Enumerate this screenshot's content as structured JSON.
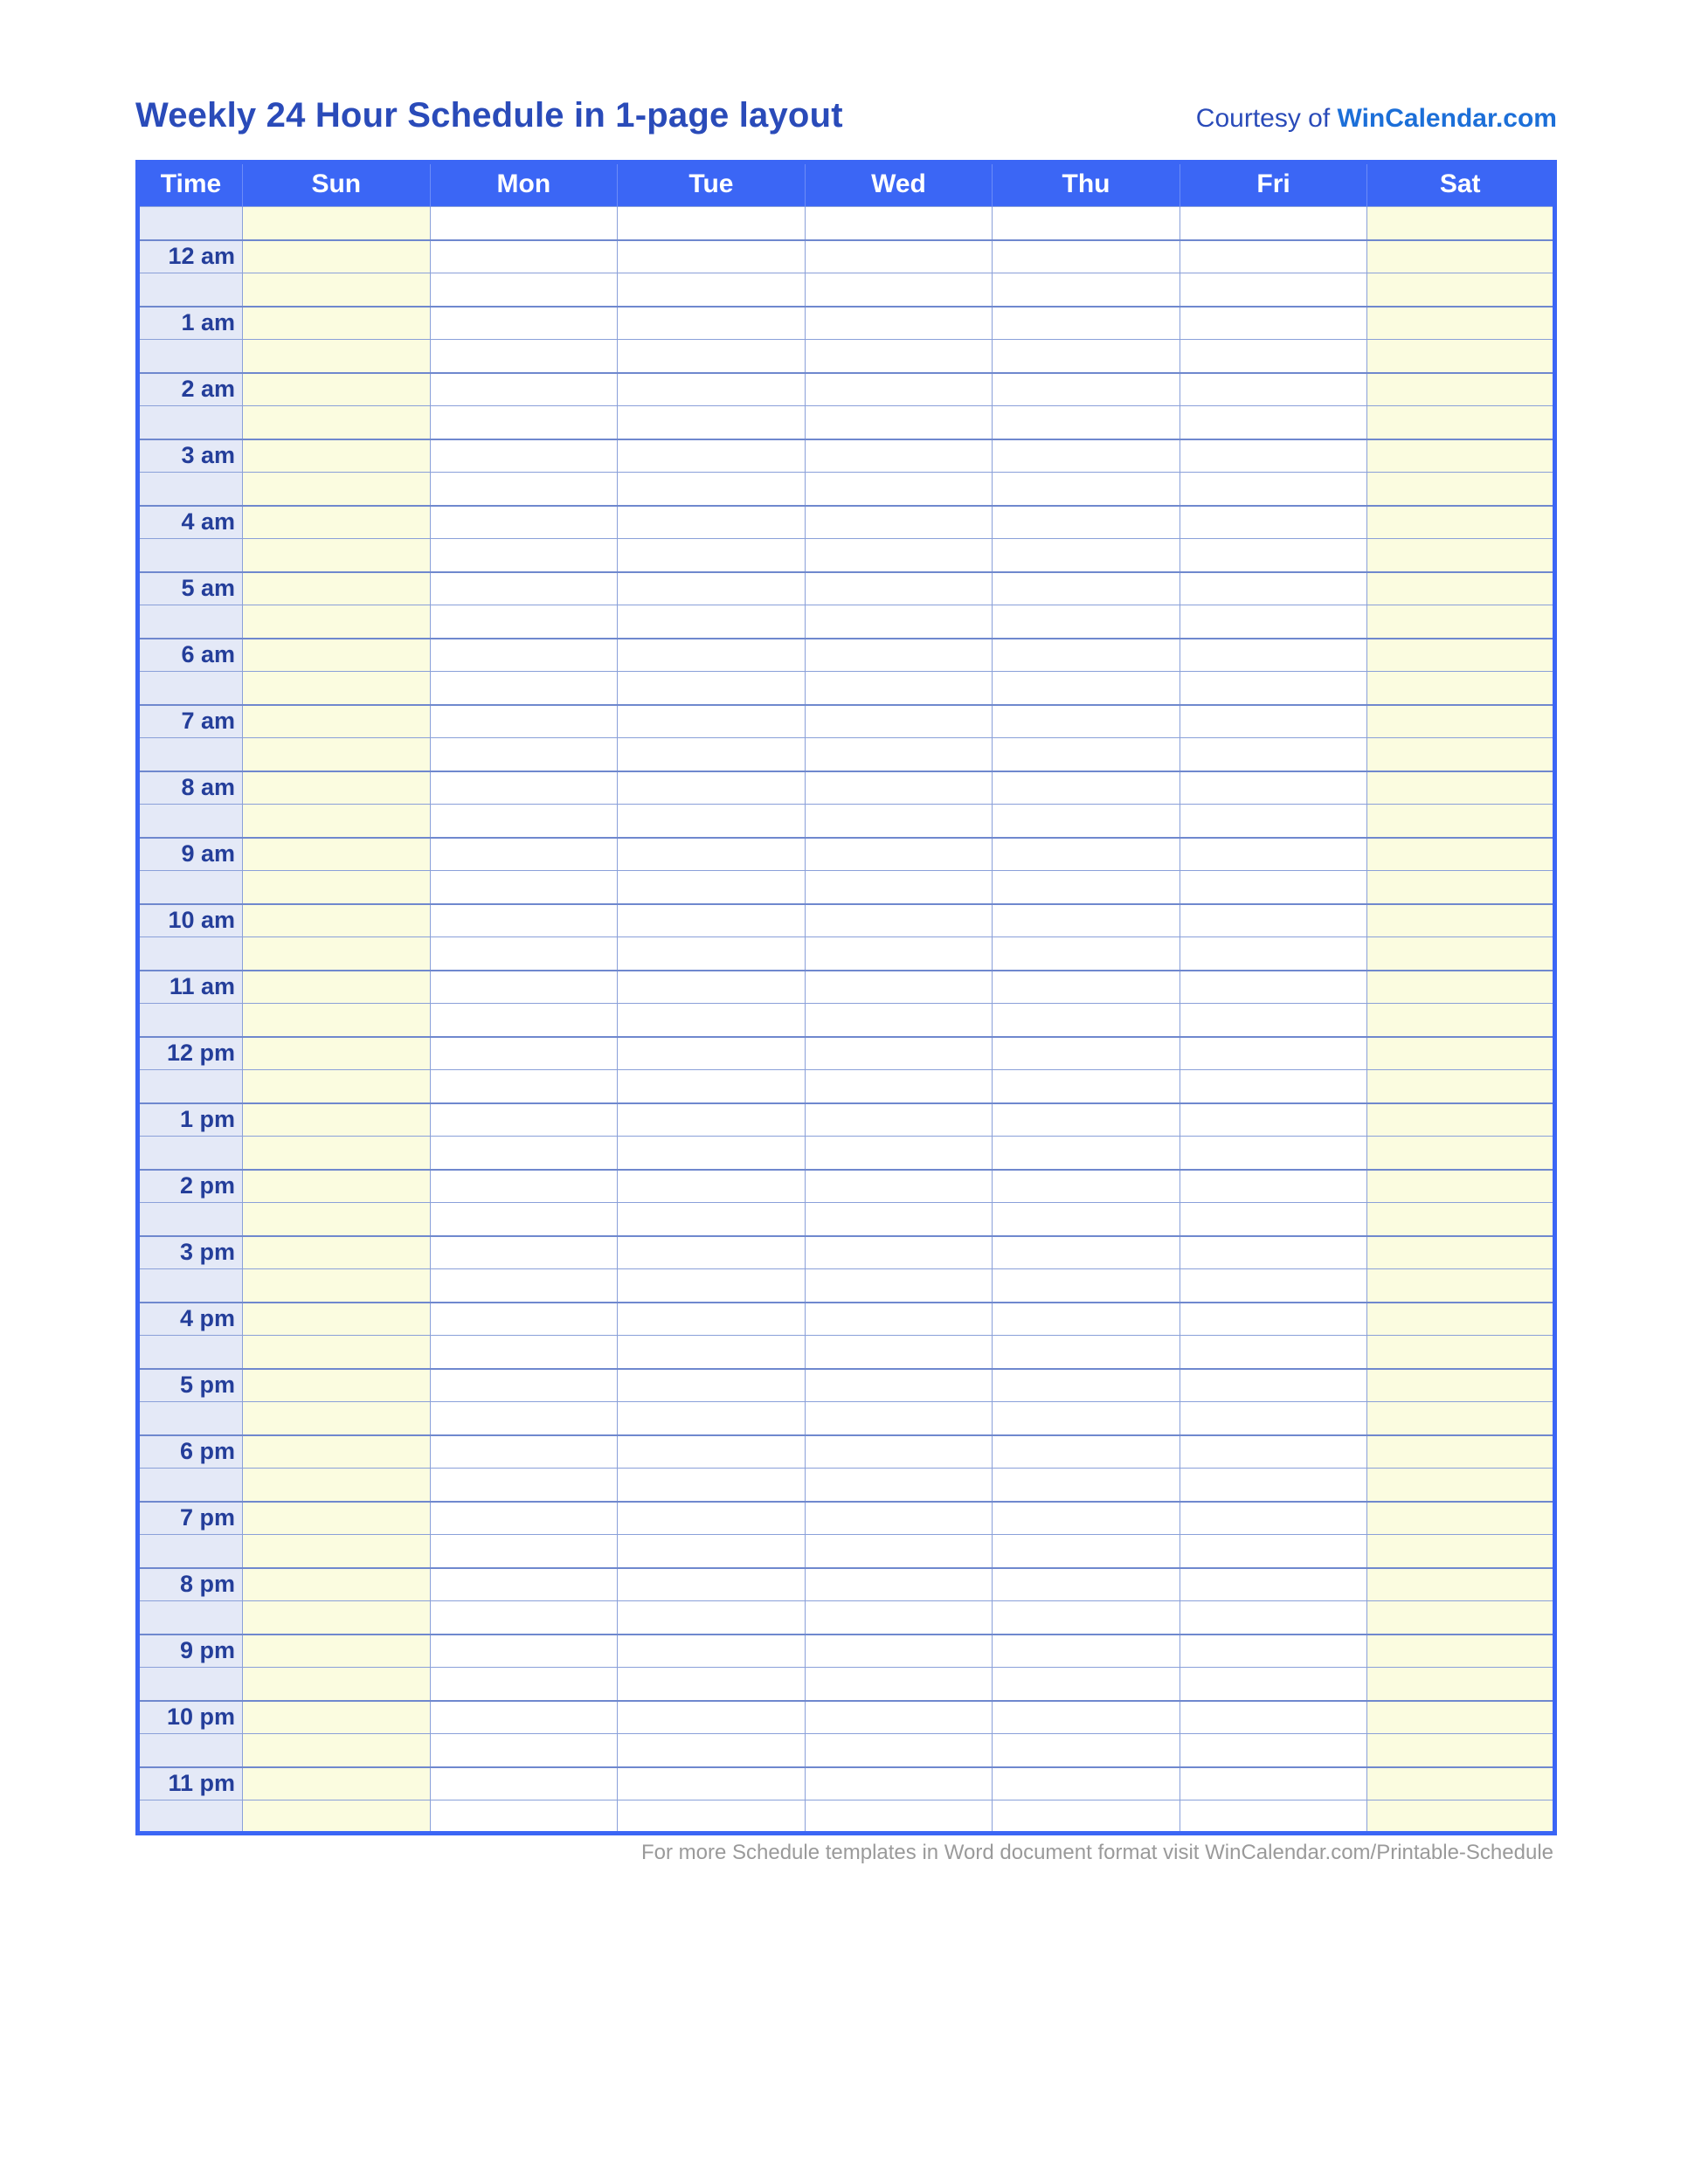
{
  "header": {
    "title": "Weekly 24 Hour Schedule in 1-page layout",
    "courtesy_prefix": "Courtesy of ",
    "courtesy_link": "WinCalendar.com"
  },
  "columns": {
    "time": "Time",
    "days": [
      "Sun",
      "Mon",
      "Tue",
      "Wed",
      "Thu",
      "Fri",
      "Sat"
    ]
  },
  "hours": [
    "12 am",
    "1 am",
    "2 am",
    "3 am",
    "4 am",
    "5 am",
    "6 am",
    "7 am",
    "8 am",
    "9 am",
    "10 am",
    "11 am",
    "12 pm",
    "1 pm",
    "2 pm",
    "3 pm",
    "4 pm",
    "5 pm",
    "6 pm",
    "7 pm",
    "8 pm",
    "9 pm",
    "10 pm",
    "11 pm"
  ],
  "footer": {
    "prefix": "For more Schedule templates in Word document format visit ",
    "link": "WinCalendar.com/Printable-Schedule"
  }
}
